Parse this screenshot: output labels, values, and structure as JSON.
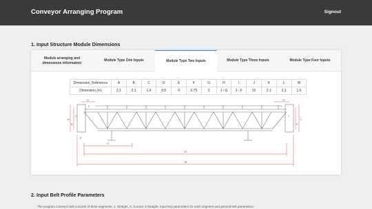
{
  "header": {
    "title": "Conveyor Arranging Program",
    "signout_label": "Signout"
  },
  "section1": {
    "title": "1. Input Structure Module Dimensions"
  },
  "tabs": [
    {
      "label_line1": "Module arranging and",
      "label_line2": "dimensions information",
      "active": false
    },
    {
      "label_line1": "Module Type One Inputs",
      "label_line2": "",
      "active": false
    },
    {
      "label_line1": "Module Type Two Inputs",
      "label_line2": "",
      "active": true
    },
    {
      "label_line1": "Module Type Three Inputs",
      "label_line2": "",
      "active": false
    },
    {
      "label_line1": "Module Type Four Inputs",
      "label_line2": "",
      "active": false
    }
  ],
  "dimension_table": {
    "ref_label": "Dimension_Reference",
    "dim_label": "Dimension (m)",
    "columns": [
      "A",
      "B",
      "C",
      "D",
      "E",
      "F",
      "G",
      "H",
      "I",
      "J",
      "K",
      "L",
      "M"
    ],
    "values": [
      "2.1",
      "2.1",
      "1.6",
      "0.5",
      "0",
      "0.75",
      "3",
      "J - G",
      "J - F",
      "16",
      "2.1",
      "2.1",
      "1.6"
    ]
  },
  "drawing": {
    "labels": [
      "A",
      "B",
      "C",
      "D",
      "E",
      "F",
      "G",
      "H",
      "I",
      "J",
      "K",
      "L",
      "M",
      "N"
    ]
  },
  "section2": {
    "title": "2. Input Belt Profile Parameters",
    "paragraph": "The program conveyor belt consists of three segments: 1. Straight, 2. Curved, 3 Straight. Input key parameters for each segment and general belt parameters:"
  }
}
